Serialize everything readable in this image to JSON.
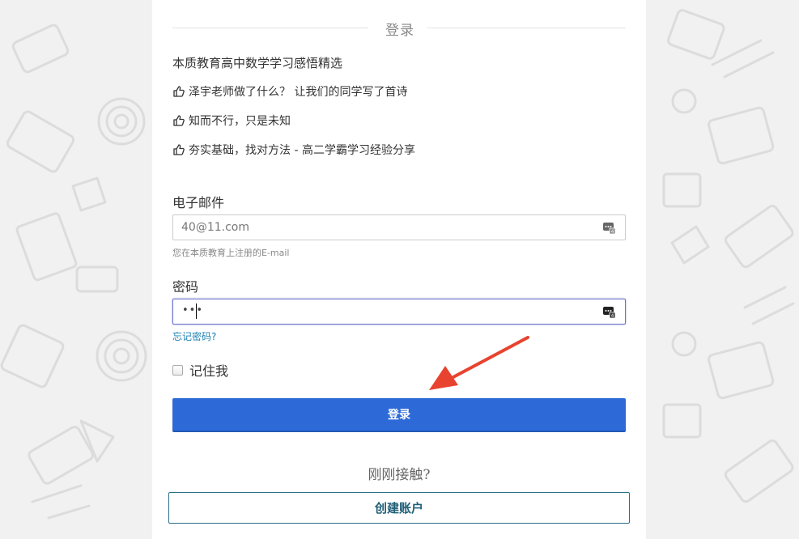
{
  "heading": "登录",
  "featured": {
    "title": "本质教育高中数学学习感悟精选",
    "links": [
      "泽宇老师做了什么？ 让我们的同学写了首诗",
      "知而不行，只是未知",
      "夯实基础，找对方法 - 高二学霸学习经验分享"
    ]
  },
  "email": {
    "label": "电子邮件",
    "value": "40@11.com",
    "help": "您在本质教育上注册的E-mail"
  },
  "password": {
    "label": "密码",
    "masked": "•••"
  },
  "forgot_link": "忘记密码?",
  "remember_label": "记住我",
  "login_button": "登录",
  "signup_prompt": "刚刚接触?",
  "create_account_button": "创建账户",
  "icons": {
    "thumb": "thumbs-up-outline-icon",
    "password_manager": "keepass-icon",
    "annotation": "red-arrow"
  },
  "colors": {
    "primary": "#2d6ad8",
    "link": "#1a7fb0",
    "create_border": "#2a6e86",
    "arrow": "#e8432f"
  }
}
